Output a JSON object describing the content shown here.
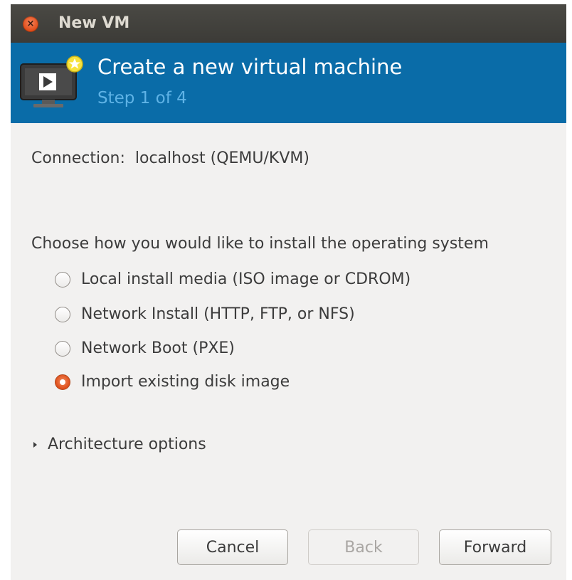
{
  "window": {
    "title": "New VM",
    "close_icon": "close-icon",
    "accent_color": "#dd4814"
  },
  "header": {
    "icon": "new-vm-monitor-icon",
    "title": "Create a new virtual machine",
    "step": "Step 1 of 4",
    "background_color": "#0a6ca8"
  },
  "connection": {
    "label": "Connection:",
    "value": "localhost (QEMU/KVM)",
    "text": "Connection:  localhost (QEMU/KVM)"
  },
  "install": {
    "prompt": "Choose how you would like to install the operating system",
    "options": [
      {
        "label": "Local install media (ISO image or CDROM)",
        "checked": false
      },
      {
        "label": "Network Install (HTTP, FTP, or NFS)",
        "checked": false
      },
      {
        "label": "Network Boot (PXE)",
        "checked": false
      },
      {
        "label": "Import existing disk image",
        "checked": true
      }
    ]
  },
  "architecture": {
    "label": "Architecture options",
    "expanded": false
  },
  "buttons": {
    "cancel": "Cancel",
    "back": "Back",
    "back_enabled": false,
    "forward": "Forward"
  }
}
